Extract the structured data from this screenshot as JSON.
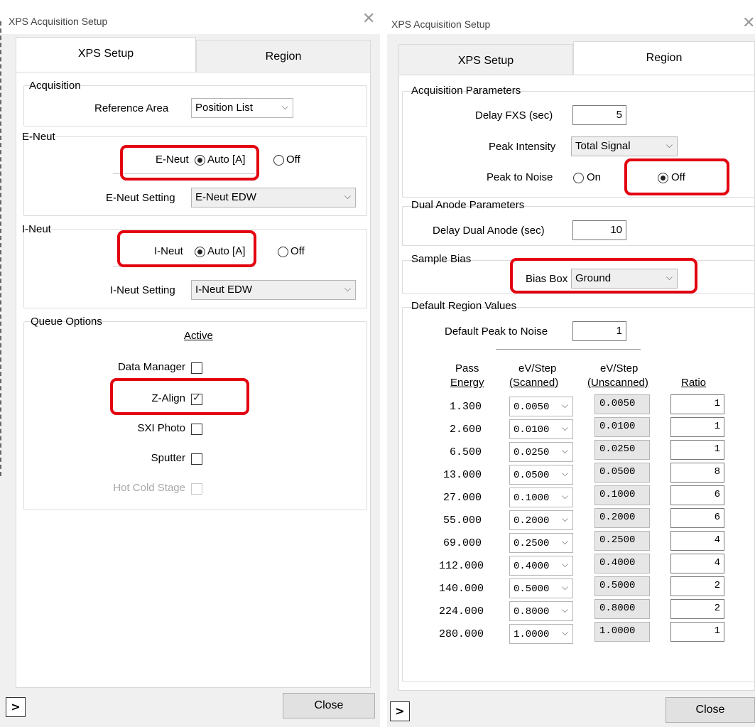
{
  "left": {
    "title": "XPS Acquisition Setup",
    "tabs": [
      "XPS Setup",
      "Region"
    ],
    "acquisition": {
      "label": "Acquisition",
      "ref_area_label": "Reference Area",
      "ref_area_value": "Position List"
    },
    "eneut": {
      "label": "E-Neut",
      "field_label": "E-Neut",
      "auto_label": "Auto [A]",
      "off_label": "Off",
      "setting_label": "E-Neut Setting",
      "setting_value": "E-Neut EDW"
    },
    "ineut": {
      "label": "I-Neut",
      "field_label": "I-Neut",
      "auto_label": "Auto [A]",
      "off_label": "Off",
      "setting_label": "I-Neut Setting",
      "setting_value": "I-Neut EDW"
    },
    "queue": {
      "label": "Queue Options",
      "active_label": "Active",
      "items": [
        {
          "label": "Data Manager",
          "checked": false,
          "disabled": false
        },
        {
          "label": "Z-Align",
          "checked": true,
          "disabled": false
        },
        {
          "label": "SXI Photo",
          "checked": false,
          "disabled": false
        },
        {
          "label": "Sputter",
          "checked": false,
          "disabled": false
        },
        {
          "label": "Hot Cold Stage",
          "checked": false,
          "disabled": true
        }
      ]
    },
    "close_label": "Close",
    "expand_glyph": ">"
  },
  "right": {
    "title": "XPS Acquisition Setup",
    "tabs": [
      "XPS Setup",
      "Region"
    ],
    "acq_params": {
      "label": "Acquisition Parameters",
      "delay_label": "Delay FXS (sec)",
      "delay_value": "5",
      "peak_intensity_label": "Peak Intensity",
      "peak_intensity_value": "Total Signal",
      "peak_noise_label": "Peak to Noise",
      "on_label": "On",
      "off_label": "Off"
    },
    "dual_anode": {
      "label": "Dual Anode Parameters",
      "delay_label": "Delay Dual Anode (sec)",
      "delay_value": "10"
    },
    "sample_bias": {
      "label": "Sample Bias",
      "bias_label": "Bias Box",
      "bias_value": "Ground"
    },
    "defaults": {
      "label": "Default Region Values",
      "peak_noise_label": "Default Peak to Noise",
      "peak_noise_value": "1",
      "headers": {
        "pass_top": "Pass",
        "pass_bottom": "Energy",
        "scanned_top": "eV/Step",
        "scanned_bottom": "(Scanned)",
        "unscanned_top": "eV/Step",
        "unscanned_bottom": "(Unscanned)",
        "ratio": "Ratio"
      },
      "rows": [
        {
          "energy": "1.300",
          "scanned": "0.0050",
          "unscanned": "0.0050",
          "ratio": "1"
        },
        {
          "energy": "2.600",
          "scanned": "0.0100",
          "unscanned": "0.0100",
          "ratio": "1"
        },
        {
          "energy": "6.500",
          "scanned": "0.0250",
          "unscanned": "0.0250",
          "ratio": "1"
        },
        {
          "energy": "13.000",
          "scanned": "0.0500",
          "unscanned": "0.0500",
          "ratio": "8"
        },
        {
          "energy": "27.000",
          "scanned": "0.1000",
          "unscanned": "0.1000",
          "ratio": "6"
        },
        {
          "energy": "55.000",
          "scanned": "0.2000",
          "unscanned": "0.2000",
          "ratio": "6"
        },
        {
          "energy": "69.000",
          "scanned": "0.2500",
          "unscanned": "0.2500",
          "ratio": "4"
        },
        {
          "energy": "112.000",
          "scanned": "0.4000",
          "unscanned": "0.4000",
          "ratio": "4"
        },
        {
          "energy": "140.000",
          "scanned": "0.5000",
          "unscanned": "0.5000",
          "ratio": "2"
        },
        {
          "energy": "224.000",
          "scanned": "0.8000",
          "unscanned": "0.8000",
          "ratio": "2"
        },
        {
          "energy": "280.000",
          "scanned": "1.0000",
          "unscanned": "1.0000",
          "ratio": "1"
        }
      ]
    },
    "close_label": "Close",
    "expand_glyph": ">"
  },
  "highlight_color": "#e3000f",
  "icons": {
    "close": "close-icon",
    "chevron": "chevron-down-icon",
    "expand": "expand-arrow-icon",
    "checkmark": "checkmark-icon"
  }
}
